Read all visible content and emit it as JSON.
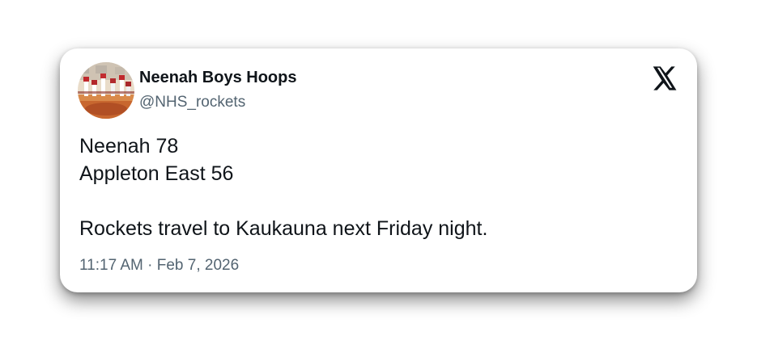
{
  "tweet": {
    "author_name": "Neenah Boys Hoops",
    "author_handle": "@NHS_rockets",
    "lines": [
      "Neenah 78",
      "Appleton East 56",
      "",
      "Rockets travel to Kaukauna next Friday night."
    ],
    "timestamp": "11:17 AM · Feb 7, 2026"
  },
  "icons": {
    "platform_logo": "x-logo-icon",
    "avatar": "team-photo-avatar"
  },
  "colors": {
    "text_primary": "#0f1419",
    "text_secondary": "#536471",
    "card_background": "#ffffff"
  }
}
